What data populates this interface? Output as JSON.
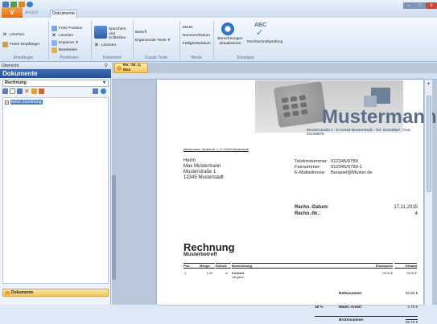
{
  "window": {
    "app_button": "V",
    "tab_ansicht": "Ansicht",
    "tab_dokumente": "Dokumente",
    "ctrl_min": "–",
    "ctrl_max": "□",
    "ctrl_close": "x"
  },
  "ribbon": {
    "empfaenger": {
      "loeschen": "Löschen",
      "freier_empfaenger": "Freier Empfänger",
      "label": "Empfänger"
    },
    "positionen": {
      "freie_position": "Freie Position",
      "loeschen": "Löschen",
      "kopieren": "Kopieren",
      "bearbeiten": "Bearbeiten",
      "label": "Positionen"
    },
    "dokument": {
      "speichern": "Speichern und Schließen",
      "loeschen": "Löschen",
      "label": "Dokument"
    },
    "zusatz": {
      "betreff": "Betreff",
      "ergaenzende_texte": "Ergänzende Texte",
      "label": "Zusatz Texte"
    },
    "werte": {
      "mwst": "MwSt.",
      "nummer_datum": "Nummer/Datum",
      "faelligkeitsdatum": "Fälligkeitsdatum",
      "label": "Werte"
    },
    "sonstiges": {
      "berechnungen": "Berechnungen aktualisieren",
      "rechtschreib": "Rechtschreibprüfung",
      "abc": "ABC",
      "label": "Sonstiges"
    }
  },
  "left_panel": {
    "header": "Übersicht",
    "title": "Dokumente",
    "select_value": "Rechnung",
    "tree_item": "keine Zuordnung",
    "footer": "Dokumente"
  },
  "doc_tab": {
    "line1": "Re.: Nr. 4,",
    "line2": "Max Mustermann"
  },
  "letter": {
    "company": "Mustermann",
    "company_dots": "...",
    "company_address": "Musterstraße 1 - D-12345 Musterstadt - Tel. 01234/567 - Fax: 0123/5678",
    "sender_line": "Mustermann, Musterstr. 1, D-12345 Musterstadt",
    "recipient": [
      "Herrn",
      "Max Mustermann",
      "Musterstraße 1",
      "12345 Musterstadt"
    ],
    "contacts": [
      {
        "label": "Telefonnummer:",
        "value": "012345/6789"
      },
      {
        "label": "Faxnummer:",
        "value": "012345/6789-1"
      },
      {
        "label": "E-Mailadresse:",
        "value": "Beispiel@Muster.de"
      }
    ],
    "date_label": "Rechn.-Datum:",
    "date_value": "17.11.2015",
    "number_label": "Rechn.-Nr.:",
    "number_value": "4",
    "title": "Rechnung",
    "subject": "Musterbetreff",
    "table": {
      "headers": [
        "Pos.",
        "Menge",
        "Einheit",
        "Bezeichnung",
        "Einzelpreis",
        "Gesamt"
      ],
      "row": {
        "pos": "1",
        "menge": "1,00",
        "einheit": "m",
        "bezeichnung": "Kurztext",
        "langtext": "Langtext",
        "einzelpreis": "25,00 €",
        "gesamt": "25,00 €"
      }
    },
    "totals": {
      "netto_label": "Nettosumme:",
      "netto_value": "25,00 €",
      "mwst_rate": "19 %",
      "mwst_label": "MwSt.-Anteil:",
      "mwst_value": "4,75 €",
      "brutto_label": "Bruttosumme:",
      "brutto_value": "29,75 €"
    }
  },
  "colors": {
    "ribbon_blue": "#244f96",
    "accent_orange": "#e46b10",
    "panel_bg": "#eef3fb"
  }
}
